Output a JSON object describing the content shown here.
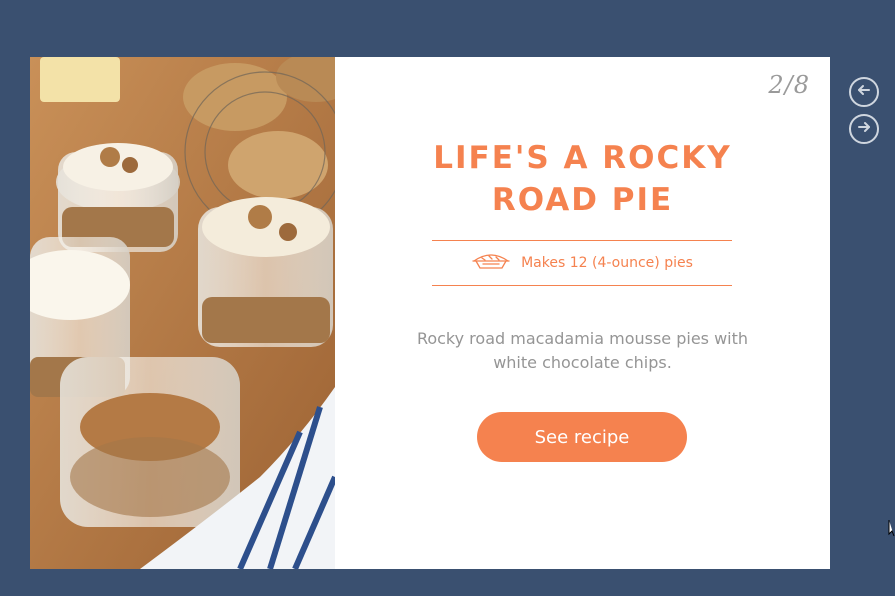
{
  "slide": {
    "counter": "2/8",
    "title_line1": "LIFE'S A ROCKY",
    "title_line2": "ROAD PIE",
    "yield_icon": "pie-icon",
    "yield_text": "Makes 12 (4-ounce) pies",
    "description_line1": "Rocky road macadamia mousse pies with",
    "description_line2": "white chocolate chips.",
    "button_label": "See recipe",
    "image_subject": "mousse-pies-in-jars-photo"
  },
  "nav": {
    "prev_icon": "arrow-left-circle-icon",
    "next_icon": "arrow-right-circle-icon"
  },
  "colors": {
    "background": "#3a5070",
    "accent": "#f5824f",
    "card": "#ffffff",
    "muted_text": "#959595"
  }
}
